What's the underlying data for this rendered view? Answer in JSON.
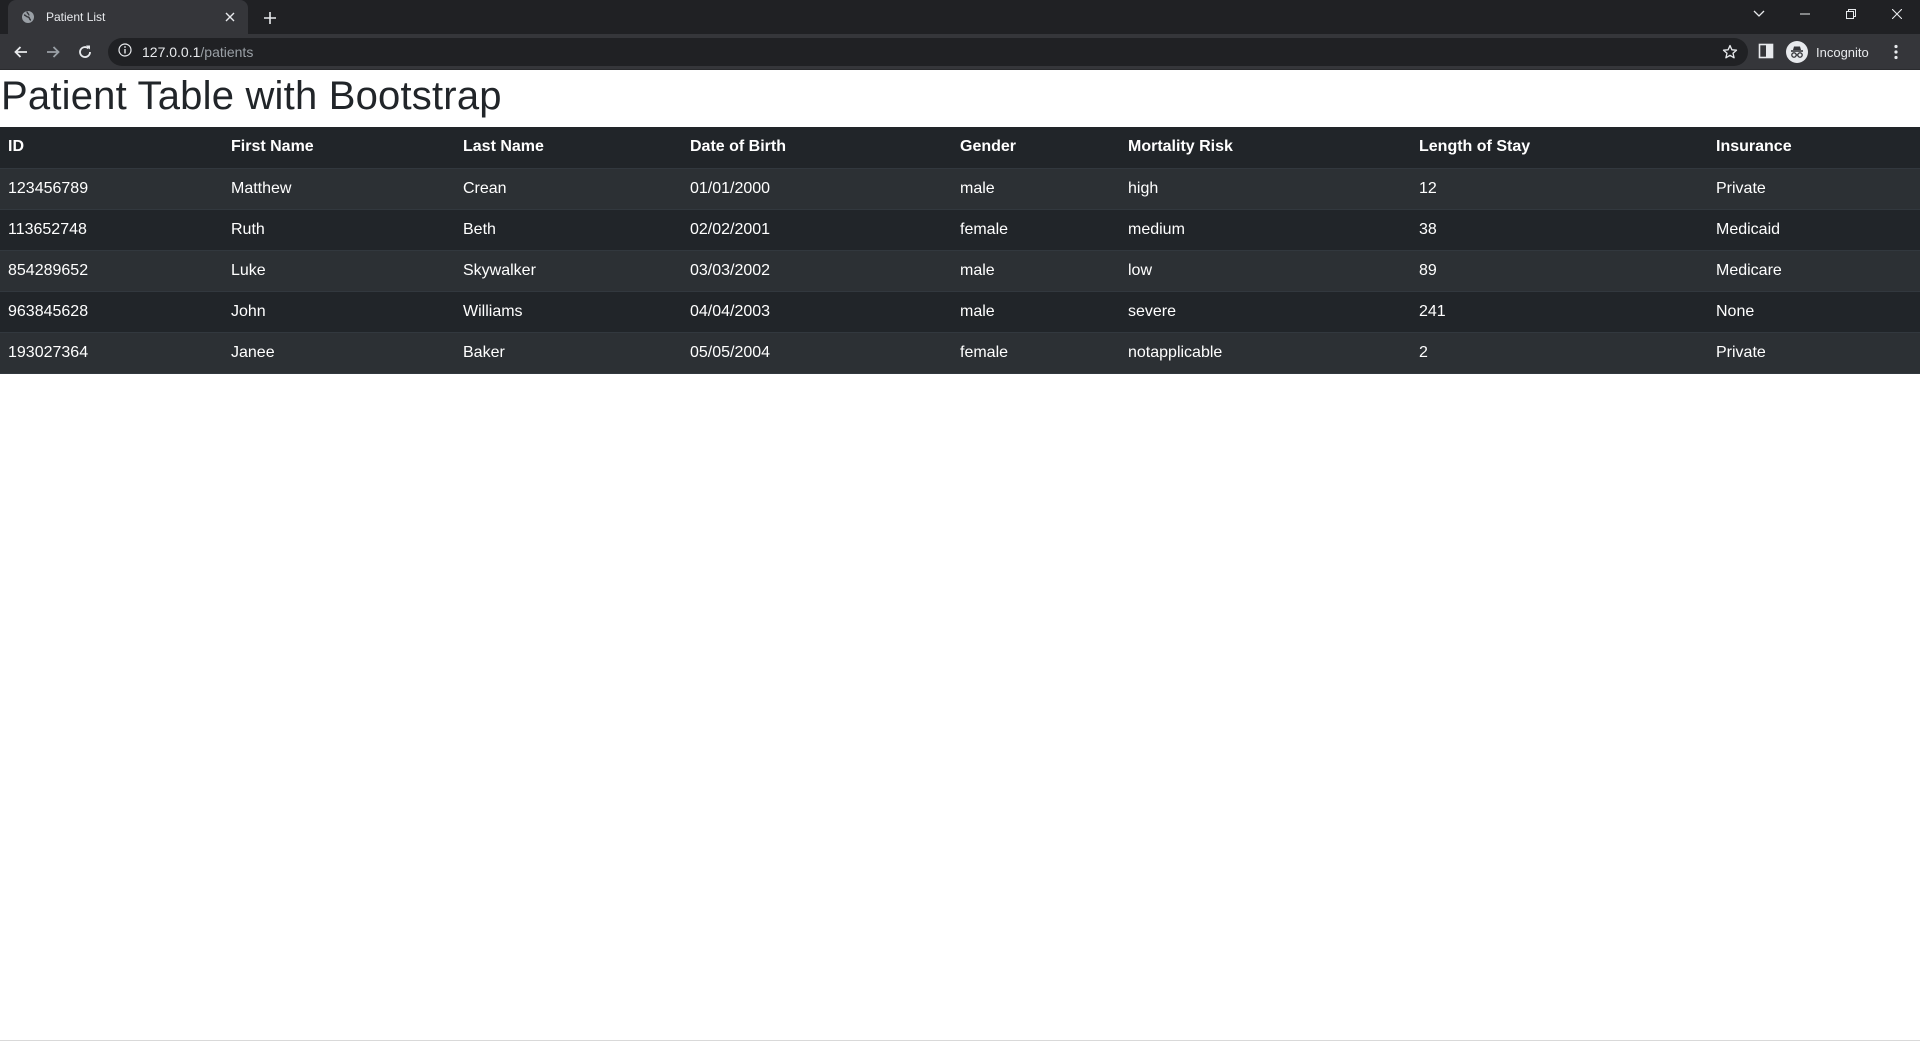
{
  "browser": {
    "tab_title": "Patient List",
    "url_host": "127.0.0.1",
    "url_path": "/patients",
    "profile_label": "Incognito"
  },
  "page": {
    "title": "Patient Table with Bootstrap"
  },
  "table": {
    "headers": [
      "ID",
      "First Name",
      "Last Name",
      "Date of Birth",
      "Gender",
      "Mortality Risk",
      "Length of Stay",
      "Insurance"
    ],
    "rows": [
      [
        "123456789",
        "Matthew",
        "Crean",
        "01/01/2000",
        "male",
        "high",
        "12",
        "Private"
      ],
      [
        "113652748",
        "Ruth",
        "Beth",
        "02/02/2001",
        "female",
        "medium",
        "38",
        "Medicaid"
      ],
      [
        "854289652",
        "Luke",
        "Skywalker",
        "03/03/2002",
        "male",
        "low",
        "89",
        "Medicare"
      ],
      [
        "963845628",
        "John",
        "Williams",
        "04/04/2003",
        "male",
        "severe",
        "241",
        "None"
      ],
      [
        "193027364",
        "Janee",
        "Baker",
        "05/05/2004",
        "female",
        "notapplicable",
        "2",
        "Private"
      ]
    ]
  },
  "colors": {
    "chrome_dark": "#202124",
    "chrome_toolbar": "#35363a",
    "table_bg": "#212529",
    "table_stripe": "#2c3034",
    "title_text": "#212529"
  },
  "icons": [
    "globe-icon",
    "close-icon",
    "plus-icon",
    "chevron-down-icon",
    "minimize-icon",
    "restore-icon",
    "back-arrow-icon",
    "forward-arrow-icon",
    "reload-icon",
    "info-icon",
    "star-icon",
    "side-panel-icon",
    "incognito-icon",
    "more-vert-icon"
  ]
}
